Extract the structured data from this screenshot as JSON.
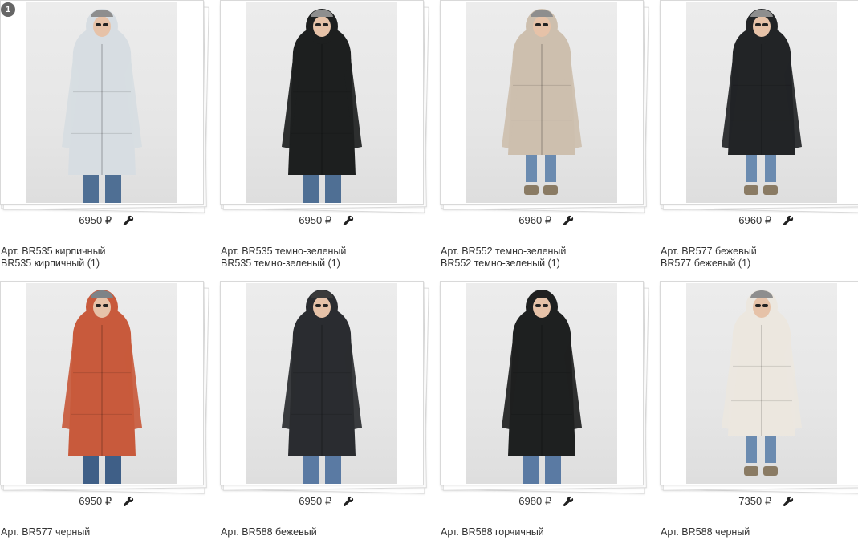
{
  "badge": "1",
  "products": [
    {
      "price": "6950 ₽",
      "title": "Арт. BR535 кирпичный",
      "subtitle": "BR535 кирпичный (1)",
      "coat": "#d7dde2",
      "hat": "#8e8e8e",
      "jeans": "#4f6f94",
      "boots": "#2a2a2a"
    },
    {
      "price": "6950 ₽",
      "title": "Арт. BR535 темно-зеленый",
      "subtitle": "BR535 темно-зеленый (1)",
      "coat": "#1d1f1f",
      "hat": "#8e8e8e",
      "jeans": "#4f6f94",
      "boots": "#2a2a2a"
    },
    {
      "price": "6960 ₽",
      "title": "Арт. BR552 темно-зеленый",
      "subtitle": "BR552 темно-зеленый (1)",
      "coat": "#cdbfae",
      "hat": "#8e8e8e",
      "jeans": "#6b8bb0",
      "boots": "#8a7b64"
    },
    {
      "price": "6960 ₽",
      "title": "Арт. BR577 бежевый",
      "subtitle": "BR577 бежевый (1)",
      "coat": "#222426",
      "hat": "#8e8e8e",
      "jeans": "#6b8bb0",
      "boots": "#8a7b64"
    },
    {
      "price": "6950 ₽",
      "title": "Арт. BR577 черный",
      "subtitle": "",
      "coat": "#c85a3c",
      "hat": "#7e8387",
      "jeans": "#3f5f87",
      "boots": "#2a2a2a"
    },
    {
      "price": "6950 ₽",
      "title": "Арт. BR588 бежевый",
      "subtitle": "",
      "coat": "#2a2c30",
      "hat": "#3a3a3a",
      "jeans": "#5a7aa3",
      "boots": "#2a2a2a"
    },
    {
      "price": "6980 ₽",
      "title": "Арт. BR588 горчичный",
      "subtitle": "",
      "coat": "#1e2020",
      "hat": "#202020",
      "jeans": "#5a7aa3",
      "boots": "#2a2a2a"
    },
    {
      "price": "7350 ₽",
      "title": "Арт. BR588 черный",
      "subtitle": "",
      "coat": "#ece7df",
      "hat": "#8e8e8e",
      "jeans": "#6b8bb0",
      "boots": "#8a7b64"
    }
  ]
}
